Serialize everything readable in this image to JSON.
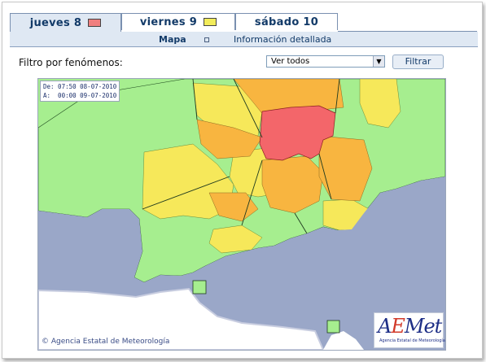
{
  "tabs": [
    {
      "label": "jueves 8",
      "level_color": "#f07f7f",
      "active": true
    },
    {
      "label": "viernes 9",
      "level_color": "#f2ec5a",
      "active": false
    },
    {
      "label": "sábado 10",
      "level_color": "",
      "active": false
    }
  ],
  "subnav": {
    "map": "Mapa",
    "detail": "Información detallada"
  },
  "filter": {
    "label": "Filtro por fenómenos:",
    "selected": "Ver todos",
    "button": "Filtrar"
  },
  "map": {
    "validity_line1": "De: 07:50 08-07-2010",
    "validity_line2": "A:  00:00 09-07-2010",
    "copyright": "© Agencia Estatal de Meteorología",
    "logo_text": "AEMet",
    "logo_subtext": "Agencia Estatal de Meteorología",
    "colors": {
      "sea": "#9aa7c8",
      "green": "#a6ee8f",
      "yellow": "#f6e85a",
      "orange": "#f8b540",
      "red": "#f3666a",
      "outside": "#ffffff"
    }
  }
}
